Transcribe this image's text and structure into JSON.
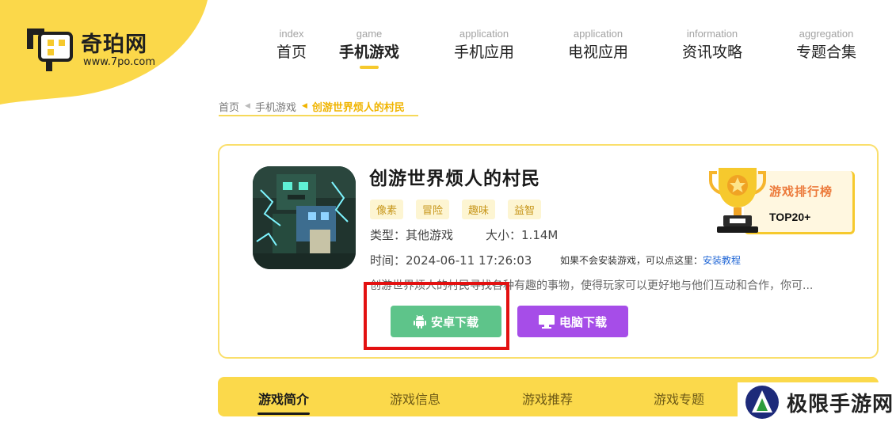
{
  "site": {
    "name": "奇珀网",
    "url": "www.7po.com"
  },
  "nav": [
    {
      "en": "index",
      "cn": "首页"
    },
    {
      "en": "game",
      "cn": "手机游戏"
    },
    {
      "en": "application",
      "cn": "手机应用"
    },
    {
      "en": "application",
      "cn": "电视应用"
    },
    {
      "en": "information",
      "cn": "资讯攻略"
    },
    {
      "en": "aggregation",
      "cn": "专题合集"
    }
  ],
  "nav_active_index": 1,
  "breadcrumb": {
    "home": "首页",
    "category": "手机游戏",
    "current": "创游世界烦人的村民"
  },
  "game": {
    "title": "创游世界烦人的村民",
    "tags": [
      "像素",
      "冒险",
      "趣味",
      "益智"
    ],
    "type_label": "类型：",
    "type_value": "其他游戏",
    "size_label": "大小：",
    "size_value": "1.14M",
    "time_label": "时间：",
    "time_value": "2024-06-11 17:26:03",
    "install_hint": "如果不会安装游戏，可以点这里：",
    "install_link": "安装教程",
    "description": "创游世界烦人的村民寻找各种有趣的事物，使得玩家可以更好地与他们互动和合作，你可..."
  },
  "buttons": {
    "android": "安卓下载",
    "pc": "电脑下载"
  },
  "rank": {
    "title": "游戏排行榜",
    "subtitle": "TOP20+"
  },
  "tabs": [
    "游戏简介",
    "游戏信息",
    "游戏推荐",
    "游戏专题"
  ],
  "watermark": "极限手游网",
  "colors": {
    "brand_yellow": "#f6c92d",
    "android_green": "#5ec48a",
    "pc_purple": "#a64de8",
    "highlight_red": "#e31010",
    "tag_text": "#c7961b",
    "link_blue": "#2368d6"
  },
  "icons": {
    "android_button": "android-icon",
    "pc_button": "monitor-icon",
    "rank": "trophy-icon",
    "breadcrumb_separator": "triangle-left-icon"
  }
}
